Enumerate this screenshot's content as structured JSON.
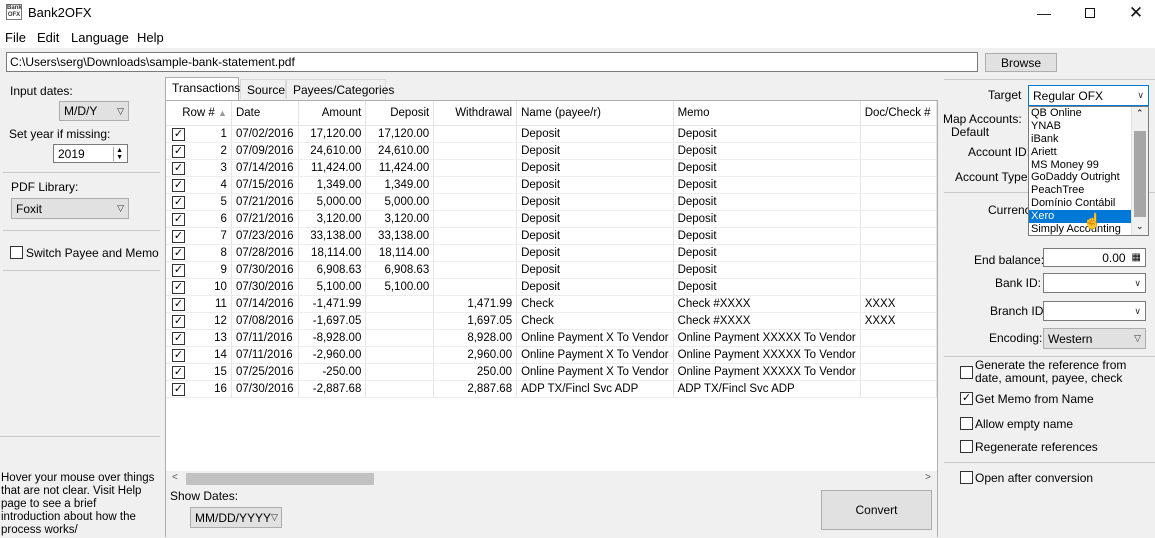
{
  "window": {
    "title": "Bank2OFX",
    "icon_text": "Bank OFX"
  },
  "menu": [
    {
      "label": "File"
    },
    {
      "label": "Edit"
    },
    {
      "label": "Language"
    },
    {
      "label": "Help"
    }
  ],
  "file_path": "C:\\Users\\serg\\Downloads\\sample-bank-statement.pdf",
  "browse_label": "Browse",
  "left": {
    "input_dates_label": "Input dates:",
    "input_dates_value": "M/D/Y",
    "set_year_label": "Set year if missing:",
    "year_value": "2019",
    "pdf_library_label": "PDF Library:",
    "pdf_library_value": "Foxit",
    "switch_label": "Switch Payee and Memo",
    "help_text": "Hover your mouse over things that are not clear. Visit Help page to see a brief introduction about how the process works/"
  },
  "tabs": [
    {
      "label": "Transactions"
    },
    {
      "label": "Source"
    },
    {
      "label": "Payees/Categories"
    }
  ],
  "grid": {
    "columns": [
      "Row #",
      "Date",
      "Amount",
      "Deposit",
      "Withdrawal",
      "Name (payee/r)",
      "Memo",
      "Doc/Check #"
    ],
    "rows": [
      {
        "row": "1",
        "date": "07/02/2016",
        "amount": "17,120.00",
        "deposit": "17,120.00",
        "withdrawal": "",
        "name": "Deposit",
        "memo": "Deposit",
        "doc": ""
      },
      {
        "row": "2",
        "date": "07/09/2016",
        "amount": "24,610.00",
        "deposit": "24,610.00",
        "withdrawal": "",
        "name": "Deposit",
        "memo": "Deposit",
        "doc": ""
      },
      {
        "row": "3",
        "date": "07/14/2016",
        "amount": "11,424.00",
        "deposit": "11,424.00",
        "withdrawal": "",
        "name": "Deposit",
        "memo": "Deposit",
        "doc": ""
      },
      {
        "row": "4",
        "date": "07/15/2016",
        "amount": "1,349.00",
        "deposit": "1,349.00",
        "withdrawal": "",
        "name": "Deposit",
        "memo": "Deposit",
        "doc": ""
      },
      {
        "row": "5",
        "date": "07/21/2016",
        "amount": "5,000.00",
        "deposit": "5,000.00",
        "withdrawal": "",
        "name": "Deposit",
        "memo": "Deposit",
        "doc": ""
      },
      {
        "row": "6",
        "date": "07/21/2016",
        "amount": "3,120.00",
        "deposit": "3,120.00",
        "withdrawal": "",
        "name": "Deposit",
        "memo": "Deposit",
        "doc": ""
      },
      {
        "row": "7",
        "date": "07/23/2016",
        "amount": "33,138.00",
        "deposit": "33,138.00",
        "withdrawal": "",
        "name": "Deposit",
        "memo": "Deposit",
        "doc": ""
      },
      {
        "row": "8",
        "date": "07/28/2016",
        "amount": "18,114.00",
        "deposit": "18,114.00",
        "withdrawal": "",
        "name": "Deposit",
        "memo": "Deposit",
        "doc": ""
      },
      {
        "row": "9",
        "date": "07/30/2016",
        "amount": "6,908.63",
        "deposit": "6,908.63",
        "withdrawal": "",
        "name": "Deposit",
        "memo": "Deposit",
        "doc": ""
      },
      {
        "row": "10",
        "date": "07/30/2016",
        "amount": "5,100.00",
        "deposit": "5,100.00",
        "withdrawal": "",
        "name": "Deposit",
        "memo": "Deposit",
        "doc": ""
      },
      {
        "row": "11",
        "date": "07/14/2016",
        "amount": "-1,471.99",
        "deposit": "",
        "withdrawal": "1,471.99",
        "name": "Check",
        "memo": "Check #XXXX",
        "doc": "XXXX"
      },
      {
        "row": "12",
        "date": "07/08/2016",
        "amount": "-1,697.05",
        "deposit": "",
        "withdrawal": "1,697.05",
        "name": "Check",
        "memo": "Check #XXXX",
        "doc": "XXXX"
      },
      {
        "row": "13",
        "date": "07/11/2016",
        "amount": "-8,928.00",
        "deposit": "",
        "withdrawal": "8,928.00",
        "name": "Online Payment X To Vendor",
        "memo": "Online Payment XXXXX To Vendor",
        "doc": ""
      },
      {
        "row": "14",
        "date": "07/11/2016",
        "amount": "-2,960.00",
        "deposit": "",
        "withdrawal": "2,960.00",
        "name": "Online Payment X To Vendor",
        "memo": "Online Payment XXXXX To Vendor",
        "doc": ""
      },
      {
        "row": "15",
        "date": "07/25/2016",
        "amount": "-250.00",
        "deposit": "",
        "withdrawal": "250.00",
        "name": "Online Payment X To Vendor",
        "memo": "Online Payment XXXXX To Vendor",
        "doc": ""
      },
      {
        "row": "16",
        "date": "07/30/2016",
        "amount": "-2,887.68",
        "deposit": "",
        "withdrawal": "2,887.68",
        "name": "ADP TX/Fincl Svc ADP",
        "memo": "ADP TX/Fincl Svc ADP",
        "doc": ""
      }
    ]
  },
  "show_dates_label": "Show Dates:",
  "show_dates_value": "MM/DD/YYYY",
  "convert_label": "Convert",
  "right": {
    "target_label": "Target",
    "target_value": "Regular OFX",
    "target_options": [
      "QB Online",
      "YNAB",
      "iBank",
      "Ariett",
      "MS Money 99",
      "GoDaddy Outright",
      "PeachTree",
      "Domínio Contábil",
      "Xero",
      "Simply Accounting"
    ],
    "target_selected": "Xero",
    "map_accounts_label": "Map Accounts:",
    "default_label": "Default",
    "account_id_label": "Account ID:",
    "account_type_label": "Account Type:",
    "currency_label": "Currenc",
    "end_balance_label": "End balance:",
    "end_balance_value": "0.00",
    "bank_id_label": "Bank ID:",
    "branch_id_label": "Branch ID",
    "encoding_label": "Encoding:",
    "encoding_value": "Western",
    "checks": [
      {
        "label": "Generate the reference from date, amount, payee, check",
        "checked": false
      },
      {
        "label": "Get Memo from Name",
        "checked": true
      },
      {
        "label": "Allow empty name",
        "checked": false
      },
      {
        "label": "Regenerate references",
        "checked": false
      }
    ],
    "open_after_label": "Open after conversion"
  }
}
